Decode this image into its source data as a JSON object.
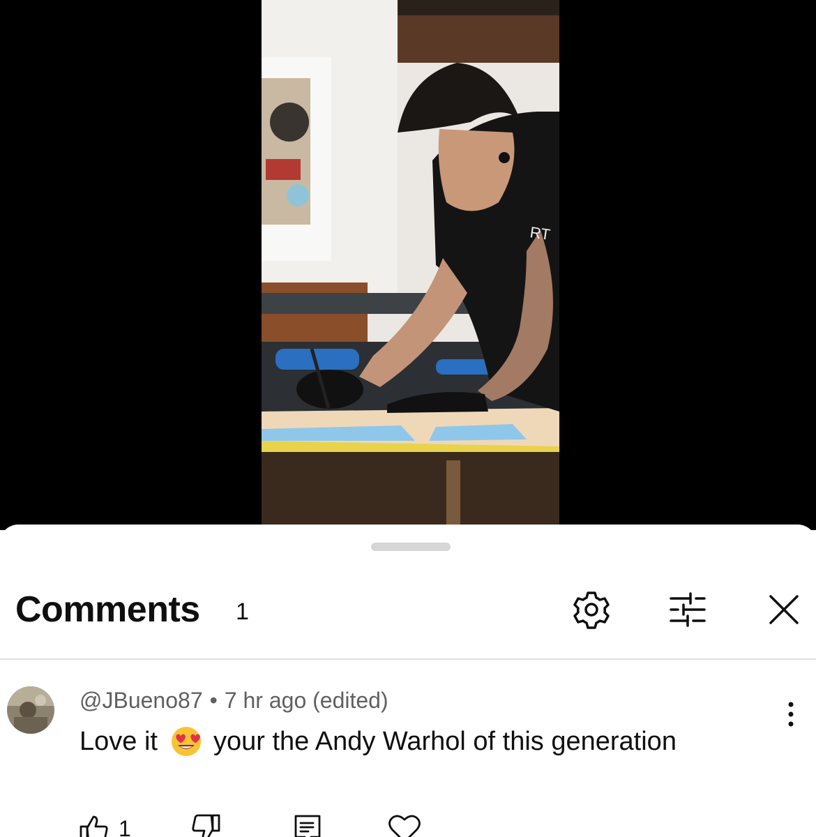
{
  "header": {
    "title": "Comments",
    "count": "1"
  },
  "comment": {
    "author": "@JBueno87",
    "separator": "•",
    "time": "7 hr ago (edited)",
    "text_before": "Love it",
    "emoji": "smiling-face-with-heart-eyes",
    "text_after": "your the Andy Warhol of this generation",
    "like_count": "1"
  },
  "icons": {
    "settings": "gear-icon",
    "filter": "sliders-icon",
    "close": "close-icon",
    "more": "more-vertical-icon",
    "like": "thumbs-up-icon",
    "dislike": "thumbs-down-icon",
    "reply": "reply-icon",
    "heart": "heart-icon"
  },
  "colors": {
    "text_primary": "#0f0f0f",
    "text_secondary": "#606060",
    "divider": "#e0e0e0",
    "handle": "#d6d6d6"
  }
}
